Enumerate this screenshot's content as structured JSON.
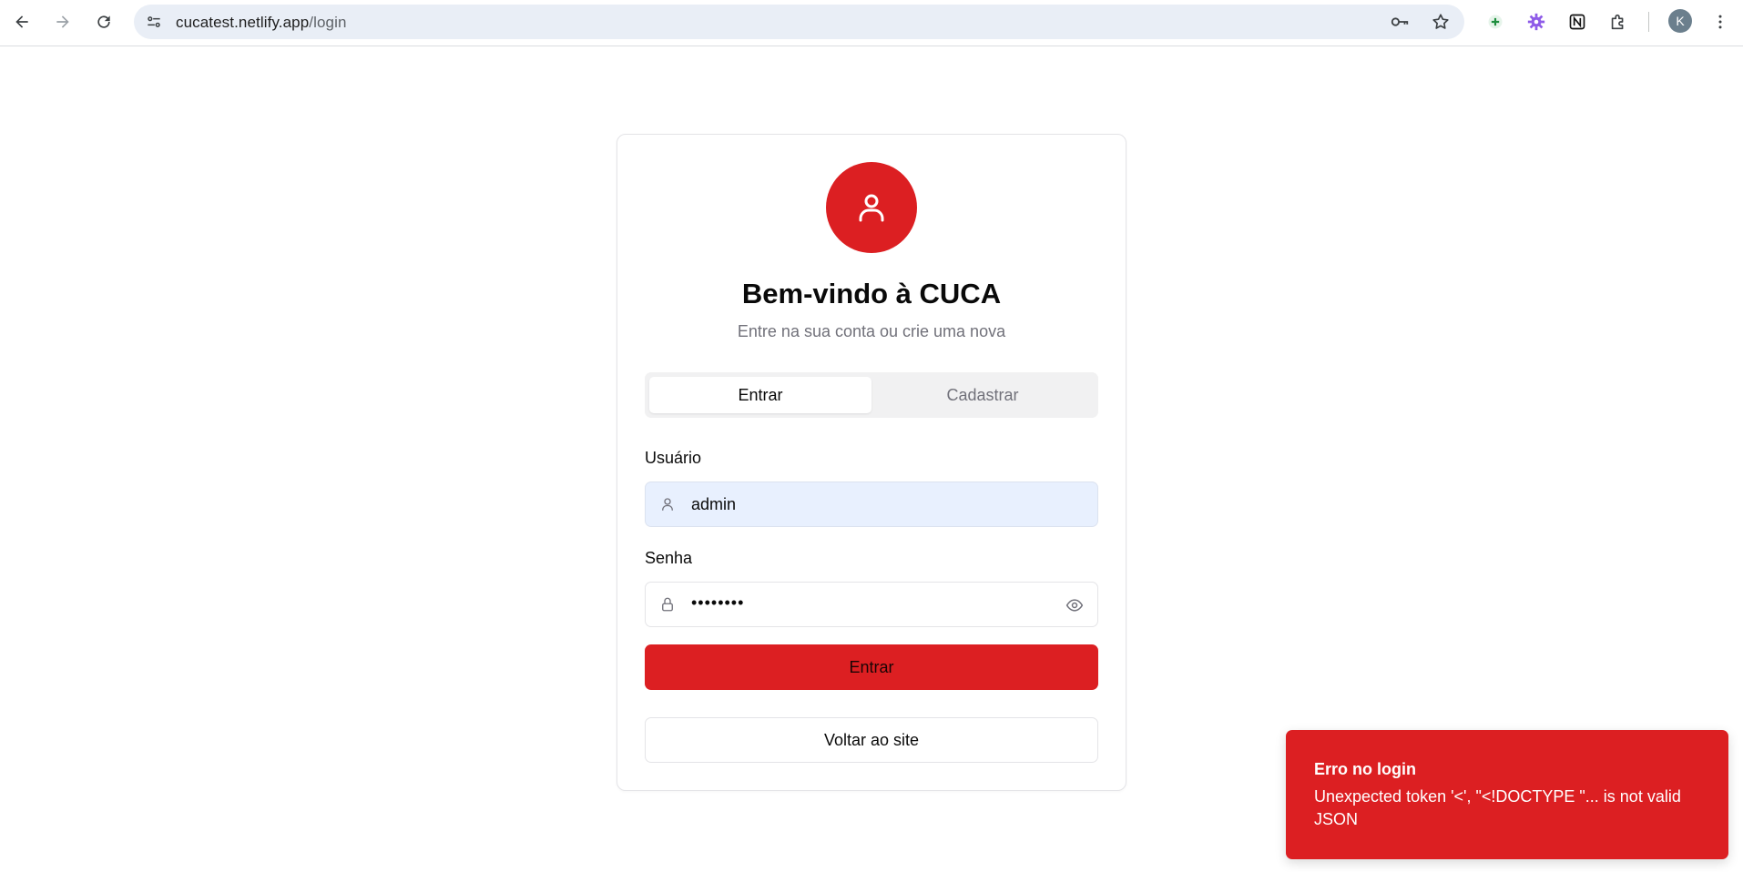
{
  "browser": {
    "url_host": "cucatest.netlify.app",
    "url_path": "/login",
    "profile_initial": "K",
    "icons": [
      "back-icon",
      "forward-icon",
      "reload-icon",
      "site-settings-icon",
      "password-key-icon",
      "bookmark-star-icon",
      "extension-plus-icon",
      "extension-gear-icon",
      "notion-icon",
      "extensions-puzzle-icon",
      "menu-kebab-icon"
    ]
  },
  "login": {
    "title": "Bem-vindo à CUCA",
    "subtitle": "Entre na sua conta ou crie uma nova",
    "tabs": [
      {
        "label": "Entrar",
        "active": true
      },
      {
        "label": "Cadastrar",
        "active": false
      }
    ],
    "username_label": "Usuário",
    "username_value": "admin",
    "password_label": "Senha",
    "password_value": "••••••••",
    "submit_label": "Entrar",
    "back_label": "Voltar ao site"
  },
  "toast": {
    "title": "Erro no login",
    "message": "Unexpected token '<', \"<!DOCTYPE \"... is not valid JSON"
  },
  "colors": {
    "brand_red": "#dc1f22",
    "autofill_bg": "#e8f0fe",
    "muted_text": "#71717a"
  }
}
